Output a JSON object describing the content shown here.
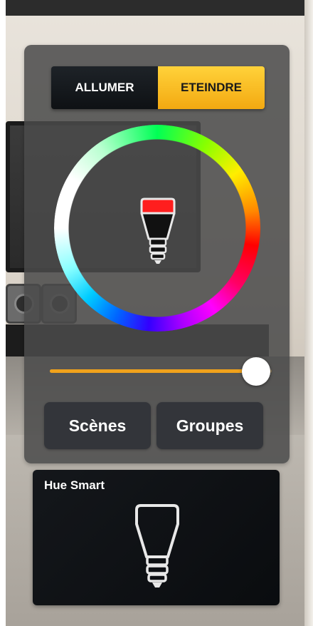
{
  "power_toggle": {
    "on_label": "ALLUMER",
    "off_label": "ETEINDRE",
    "active": "off"
  },
  "color_picker": {
    "selected_color": "#ff1e1e",
    "icon": "light-bulb-icon"
  },
  "brightness": {
    "value": 0.93,
    "fill_color": "#f0a21b"
  },
  "buttons": {
    "scenes_label": "Scènes",
    "groups_label": "Groupes"
  },
  "light_tile": {
    "name": "Hue Smart",
    "icon": "light-bulb-icon"
  },
  "colors": {
    "accent": "#f3a911",
    "panel": "#4a4a4a",
    "tile": "#0c0e11"
  }
}
